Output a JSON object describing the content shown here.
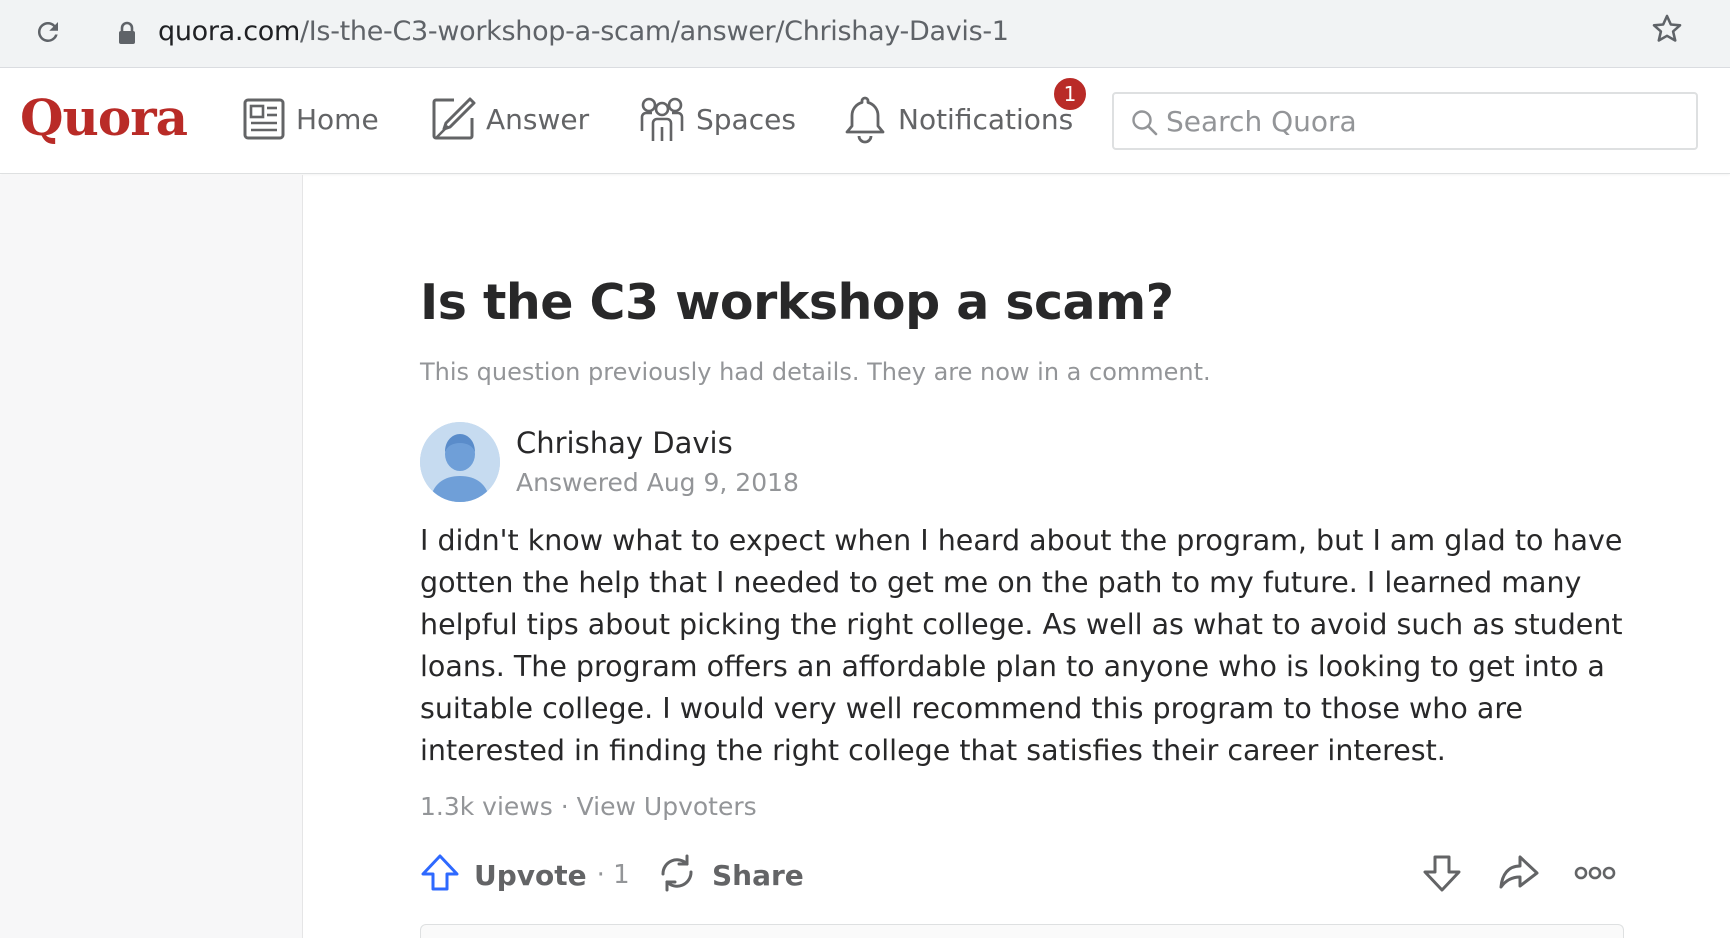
{
  "browser": {
    "url_domain": "quora.com",
    "url_path": "/Is-the-C3-workshop-a-scam/answer/Chrishay-Davis-1"
  },
  "header": {
    "logo": "Quora",
    "nav": {
      "home": "Home",
      "answer": "Answer",
      "spaces": "Spaces",
      "notifications": "Notifications"
    },
    "notification_count": "1",
    "search_placeholder": "Search Quora"
  },
  "question": {
    "title": "Is the C3 workshop a scam?",
    "note": "This question previously had details. They are now in a comment."
  },
  "answer": {
    "author": "Chrishay Davis",
    "date": "Answered Aug 9, 2018",
    "body": "I didn't know what to expect when I heard about the program, but I am glad to have gotten the help that I needed to get me on the path to my future. I learned many helpful tips about picking the right college. As well as what to avoid such as student loans. The program offers an affordable plan to anyone who is looking to get into a suitable college. I would very well recommend this program to those who are interested in finding the right college that satisfies their career interest.",
    "views": "1.3k views",
    "separator": " · ",
    "view_upvoters": "View Upvoters"
  },
  "actions": {
    "upvote": "Upvote",
    "upvote_count": "· 1",
    "share": "Share"
  },
  "colors": {
    "brand": "#b92b27",
    "upvote_blue": "#2e69ff",
    "text": "#282829",
    "muted": "#939598"
  },
  "icons": [
    "reload-icon",
    "lock-icon",
    "star-icon",
    "home-feed-icon",
    "answer-pencil-icon",
    "spaces-people-icon",
    "bell-icon",
    "search-icon",
    "upvote-arrow-icon",
    "share-cycle-icon",
    "downvote-arrow-icon",
    "forward-arrow-icon",
    "more-dots-icon"
  ]
}
